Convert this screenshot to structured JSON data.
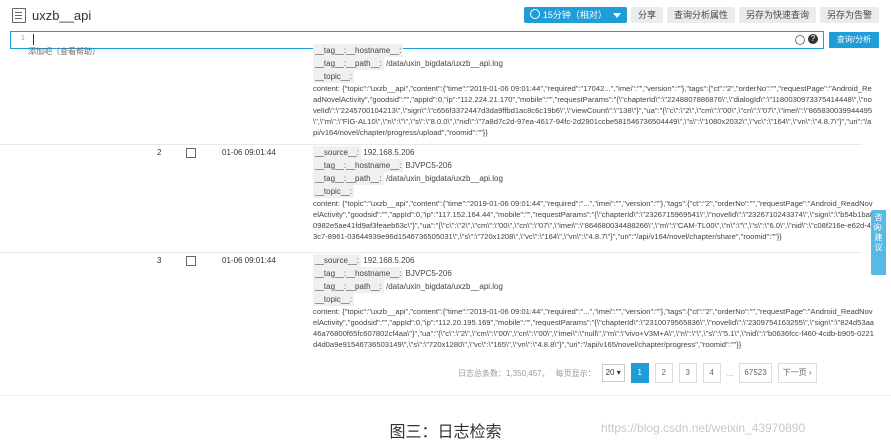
{
  "app": {
    "title": "uxzb__api"
  },
  "toolbar": {
    "time_label": "15分钟（相对）",
    "share": "分享",
    "analysis_attr": "查询分析属性",
    "save_quick": "另存为快速查询",
    "save_alert": "另存为告警"
  },
  "search": {
    "line_no": "1",
    "query_button": "查询/分析"
  },
  "left_panel": {
    "line1": "添加吧（查看帮助）",
    "link": "查看帮助"
  },
  "rows": [
    {
      "num": "",
      "time": "",
      "tag_hostname": "__tag__:__hostname__:",
      "tag_path": "__tag__:__path__:",
      "path_value": "/data/uxin_bigdata/uxzb__api.log",
      "topic": "__topic__:",
      "content_label": "content:",
      "content": "{\"topic\":\"uxzb__api\",\"content\":{\"time\":\"2019-01-06 09:01:44\",\"required\":\"17042...\",\"imei\":\"\",\"version\":\"\"},\"tags\":{\"ct\":\"2\",\"orderNo\":\"\",\"requestPage\":\"Android_ReadNovelActivity\",\"goodsid\":\"\",\"appId\":0,\"ip\":\"112.224.21.170\",\"mobile\":\"\",\"requestParams\":\"{\\\"chapterId\\\":\\\"2248807886876\\\",\\\"dialogId\\\":\\\"1180030973375414448\\\",\\\"novelId\\\":\\\"2245700104213\\\",\\\"sign\\\":\\\"c656f3372447d3da9ffbd1ac8c6c19b6\\\",\\\"viewCount\\\":\\\"138\\\"}\",\"ua\":\"{\\\"c\\\":\\\"2\\\",\\\"cm\\\":\\\"00\\\",\\\"cn\\\":\\\"07\\\",\\\"imei\\\":\\\"865830039944495\\\",\\\"m\\\":\\\"FIG-AL10\\\",\\\"n\\\":\\\"\\\",\\\"s\\\":\\\"8.0.0\\\",\\\"nid\\\":\\\"7a8d7c2d-97ea-4617-94fc-2d2901ccbe581546736504449\\\",\\\"s\\\":\\\"1080x2032\\\",\\\"vc\\\":\\\"164\\\",\\\"vn\\\":\\\"4.8.7\\\"}\",\"uri\":\"/api/v164/novel/chapter/progress/upload\",\"roomid\":\"\"}}"
    },
    {
      "num": "2",
      "time": "01-06 09:01:44",
      "source": "__source__:",
      "source_value": "192.168.5.206",
      "tag_hostname": "__tag__:__hostname__:",
      "hostname_value": "BJVPC5-206",
      "tag_path": "__tag__:__path__:",
      "path_value": "/data/uxin_bigdata/uxzb__api.log",
      "topic": "__topic__:",
      "content_label": "content:",
      "content": "{\"topic\":\"uxzb__api\",\"content\":{\"time\":\"2019-01-06 09:01:44\",\"required\":\"...\",\"imei\":\"\",\"version\":\"\"},\"tags\":{\"ct\":\"2\",\"orderNo\":\"\",\"requestPage\":\"Android_ReadNovelActivity\",\"goodsid\":\"\",\"appId\":0,\"ip\":\"117.152.164.44\",\"mobile\":\"\",\"requestParams\":\"{\\\"chapterId\\\":\\\"2326715969541\\\",\\\"novelId\\\":\\\"2326710243374\\\",\\\"sign\\\":\\\"b54b1ba80982e5ae41fd9af3feaeb63c\\\"}\",\"ua\":\"{\\\"c\\\":\\\"2\\\",\\\"cm\\\":\\\"00\\\",\\\"cn\\\":\\\"07\\\",\\\"imei\\\":\\\"864680034488266\\\",\\\"m\\\":\\\"CAM-TL00\\\",\\\"n\\\":\\\"\\\",\\\"s\\\":\\\"6.0\\\",\\\"nid\\\":\\\"c08f216e-e62d-43c7-8961-03644939e96d1546736505031\\\",\\\"s\\\":\\\"720x1208\\\",\\\"vc\\\":\\\"164\\\",\\\"vn\\\":\\\"4.8.7\\\"}\",\"uri\":\"/api/v164/novel/chapter/share\",\"roomid\":\"\"}}"
    },
    {
      "num": "3",
      "time": "01-06 09:01:44",
      "source": "__source__:",
      "source_value": "192.168.5.206",
      "tag_hostname": "__tag__:__hostname__:",
      "hostname_value": "BJVPC5-206",
      "tag_path": "__tag__:__path__:",
      "path_value": "/data/uxin_bigdata/uxzb__api.log",
      "topic": "__topic__:",
      "content_label": "content:",
      "content": "{\"topic\":\"uxzb__api\",\"content\":{\"time\":\"2019-01-06 09:01:44\",\"required\":\"...\",\"imei\":\"\",\"version\":\"\"},\"tags\":{\"ct\":\"2\",\"orderNo\":\"\",\"requestPage\":\"Android_ReadNovelActivity\",\"goodsid\":\"\",\"appId\":0,\"ip\":\"112.20.195.169\",\"mobile\":\"\",\"requestParams\":\"{\\\"chapterId\\\":\\\"2310079565836\\\",\\\"novelId\\\":\\\"2309754163255\\\",\\\"sign\\\":\\\"824d53aa46a76800f65fc607802cf4aa\\\"}\",\"ua\":\"{\\\"c\\\":\\\"2\\\",\\\"cm\\\":\\\"00\\\",\\\"cn\\\":\\\"00\\\",\\\"imei\\\":\\\"null\\\",\\\"m\\\":\\\"vivo+V3M+A\\\",\\\"n\\\":\\\"\\\",\\\"s\\\":\\\"5.1\\\",\\\"nid\\\":\\\"b0636fcc-f460-4cdb-b905-0221d4d0a9e91546736503149\\\",\\\"s\\\":\\\"720x1280\\\",\\\"vc\\\":\\\"165\\\",\\\"vn\\\":\\\"4.8.8\\\"}\",\"uri\":\"/api/v165/novel/chapter/progress\",\"roomid\":\"\"}}"
    }
  ],
  "pager": {
    "total_label": "日志总条数：1,350,457，",
    "page_size_label": "每页显示：",
    "page_size": "20",
    "pages": [
      "1",
      "2",
      "3",
      "4"
    ],
    "ellipsis": "...",
    "last": "67523",
    "next": "下一页"
  },
  "side_float": {
    "label": "咨询·建议"
  },
  "caption": "图三：日志检索",
  "watermark": "https://blog.csdn.net/weixin_43970890"
}
